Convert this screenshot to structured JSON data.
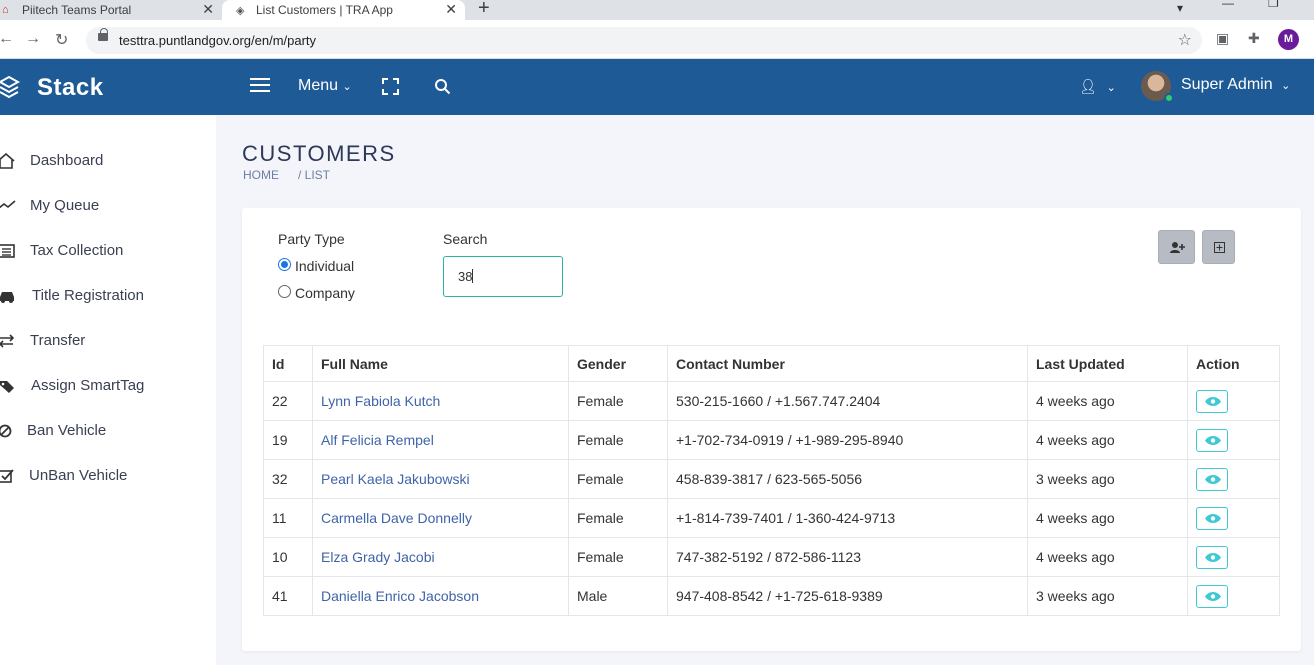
{
  "browser": {
    "tabs": [
      {
        "title": "Piitech Teams Portal"
      },
      {
        "title": "List Customers | TRA App"
      }
    ],
    "url": "testtra.puntlandgov.org/en/m/party",
    "profile_initial": "M"
  },
  "header": {
    "brand": "Stack",
    "menu_label": "Menu",
    "user_name": "Super Admin"
  },
  "sidebar": {
    "items": [
      {
        "label": "Dashboard",
        "icon": "home-icon"
      },
      {
        "label": "My Queue",
        "icon": "trend-icon"
      },
      {
        "label": "Tax Collection",
        "icon": "list-icon"
      },
      {
        "label": "Title Registration",
        "icon": "car-icon"
      },
      {
        "label": "Transfer",
        "icon": "exchange-icon"
      },
      {
        "label": "Assign SmartTag",
        "icon": "tags-icon"
      },
      {
        "label": "Ban Vehicle",
        "icon": "ban-icon"
      },
      {
        "label": "UnBan Vehicle",
        "icon": "check-square-icon"
      }
    ]
  },
  "page": {
    "title": "CUSTOMERS",
    "breadcrumb": [
      "HOME",
      "/ LIST"
    ]
  },
  "filters": {
    "party_type_label": "Party Type",
    "options": [
      "Individual",
      "Company"
    ],
    "selected": "Individual",
    "search_label": "Search",
    "search_value": "38"
  },
  "table": {
    "columns": [
      "Id",
      "Full Name",
      "Gender",
      "Contact Number",
      "Last Updated",
      "Action"
    ],
    "rows": [
      {
        "id": "22",
        "name": "Lynn Fabiola Kutch",
        "gender": "Female",
        "contact": "530-215-1660 / +1.567.747.2404",
        "updated": "4 weeks ago"
      },
      {
        "id": "19",
        "name": "Alf Felicia Rempel",
        "gender": "Female",
        "contact": "+1-702-734-0919 / +1-989-295-8940",
        "updated": "4 weeks ago"
      },
      {
        "id": "32",
        "name": "Pearl Kaela Jakubowski",
        "gender": "Female",
        "contact": "458-839-3817 / 623-565-5056",
        "updated": "3 weeks ago"
      },
      {
        "id": "11",
        "name": "Carmella Dave Donnelly",
        "gender": "Female",
        "contact": "+1-814-739-7401 / 1-360-424-9713",
        "updated": "4 weeks ago"
      },
      {
        "id": "10",
        "name": "Elza Grady Jacobi",
        "gender": "Female",
        "contact": "747-382-5192 / 872-586-1123",
        "updated": "4 weeks ago"
      },
      {
        "id": "41",
        "name": "Daniella Enrico Jacobson",
        "gender": "Male",
        "contact": "947-408-8542 / +1-725-618-9389",
        "updated": "3 weeks ago"
      }
    ]
  },
  "colors": {
    "header_bg": "#1e5a96",
    "link": "#3f64a8",
    "accent_teal": "#3fc9d4"
  }
}
